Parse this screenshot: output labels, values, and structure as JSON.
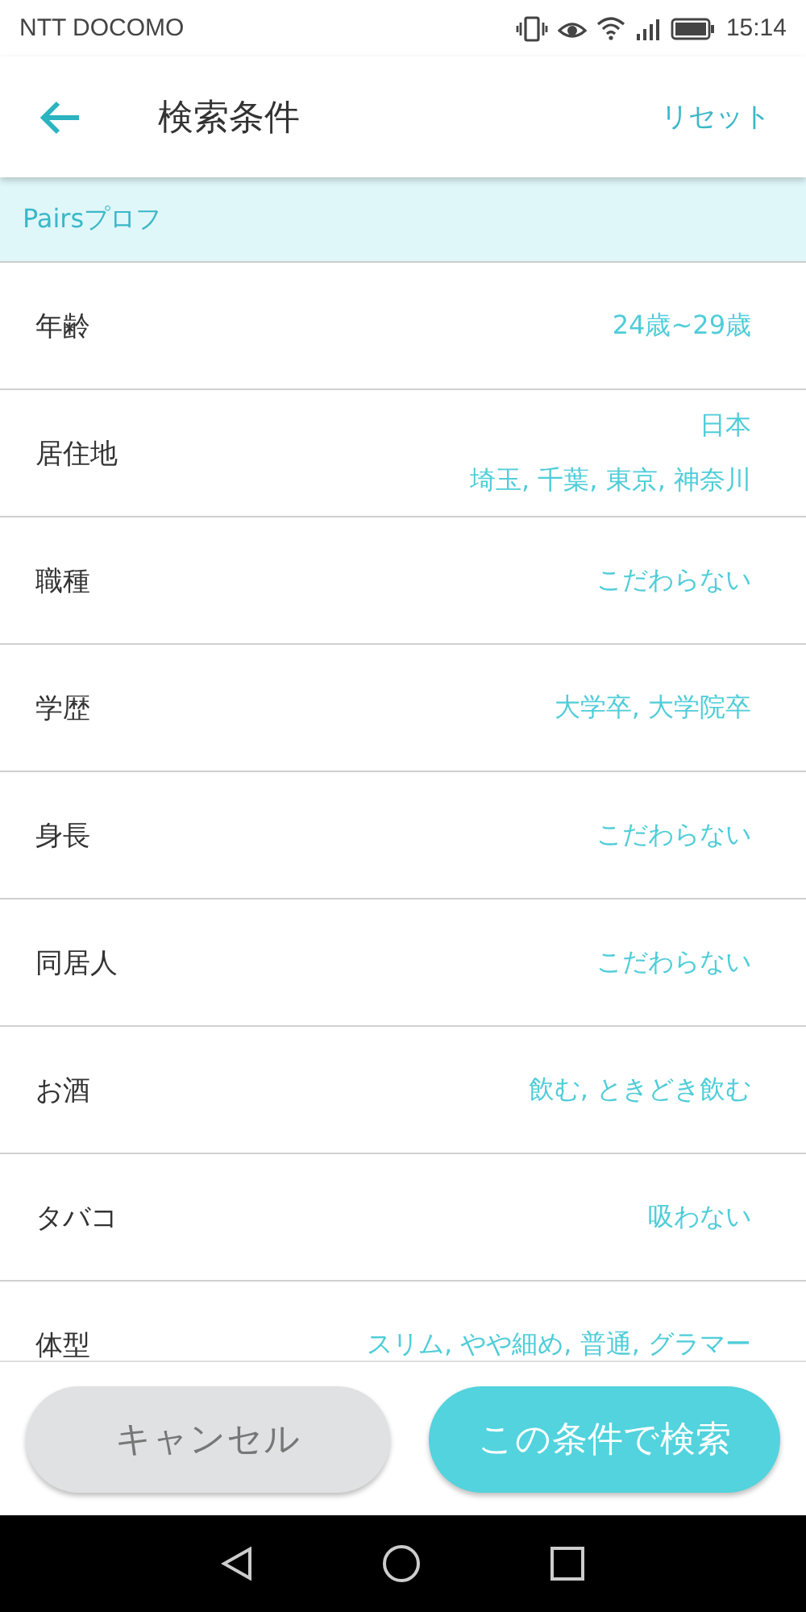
{
  "status_bar": {
    "carrier": "NTT DOCOMO",
    "time": "15:14"
  },
  "header": {
    "title": "検索条件",
    "reset": "リセット"
  },
  "section": {
    "title": "Pairsプロフ"
  },
  "rows": [
    {
      "label": "年齢",
      "values": [
        "24歳~29歳"
      ]
    },
    {
      "label": "居住地",
      "values": [
        "日本",
        "埼玉, 千葉, 東京, 神奈川"
      ]
    },
    {
      "label": "職種",
      "values": [
        "こだわらない"
      ]
    },
    {
      "label": "学歴",
      "values": [
        "大学卒, 大学院卒"
      ]
    },
    {
      "label": "身長",
      "values": [
        "こだわらない"
      ]
    },
    {
      "label": "同居人",
      "values": [
        "こだわらない"
      ]
    },
    {
      "label": "お酒",
      "values": [
        "飲む, ときどき飲む"
      ]
    },
    {
      "label": "タバコ",
      "values": [
        "吸わない"
      ]
    },
    {
      "label": "体型",
      "values": [
        "スリム, やや細め, 普通, グラマー"
      ]
    }
  ],
  "buttons": {
    "cancel": "キャンセル",
    "search": "この条件で検索"
  }
}
